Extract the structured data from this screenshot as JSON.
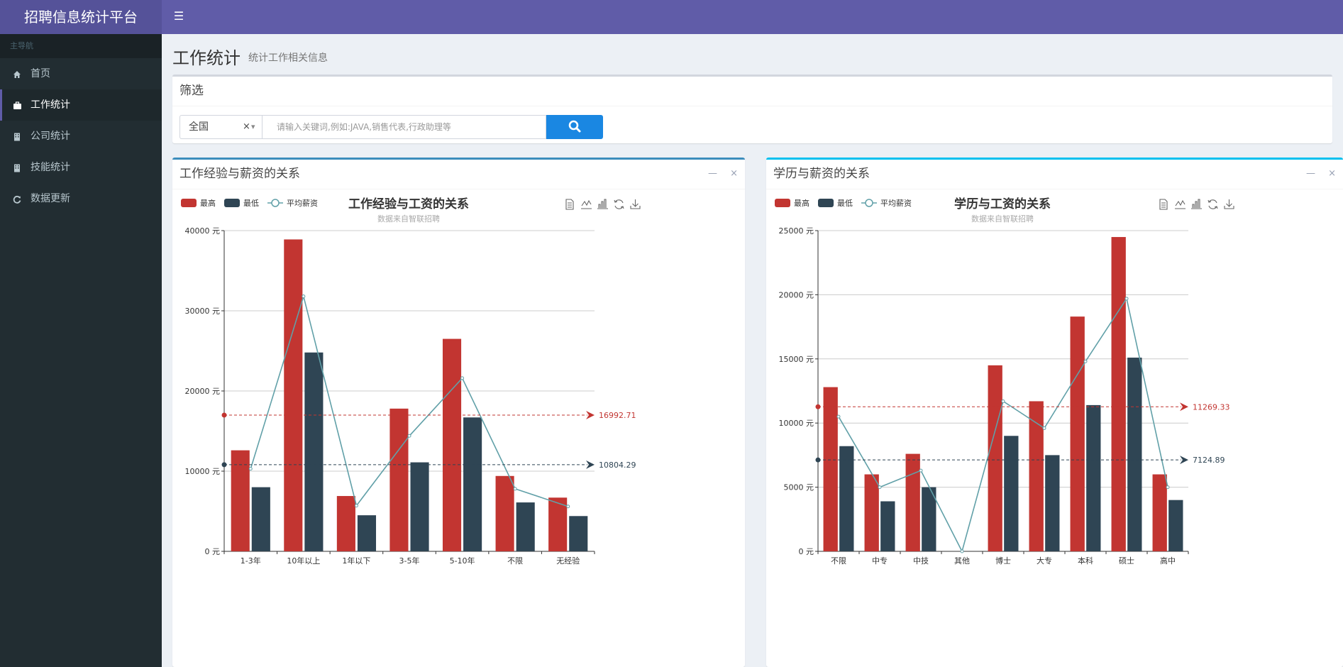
{
  "app": {
    "title": "招聘信息统计平台"
  },
  "sidebar": {
    "header": "主导航",
    "items": [
      {
        "label": "首页",
        "icon": "home-icon"
      },
      {
        "label": "工作统计",
        "icon": "briefcase-icon",
        "active": true
      },
      {
        "label": "公司统计",
        "icon": "building-icon"
      },
      {
        "label": "技能统计",
        "icon": "building-icon"
      },
      {
        "label": "数据更新",
        "icon": "refresh-icon"
      }
    ]
  },
  "page": {
    "title": "工作统计",
    "subtitle": "统计工作相关信息"
  },
  "filter": {
    "title": "筛选",
    "region_value": "全国",
    "search_placeholder": "请输入关键词,例如:JAVA,销售代表,行政助理等"
  },
  "colors": {
    "max": "#c23531",
    "min": "#2f4554",
    "avg": "#61a0a8",
    "header": "#605ca8",
    "sidebar": "#222d32",
    "search_btn": "#1a87e2"
  },
  "chart_data": [
    {
      "box_title": "工作经验与薪资的关系",
      "type": "bar",
      "title": "工作经验与工资的关系",
      "subtitle": "数据来自智联招聘",
      "legend": [
        "最高",
        "最低",
        "平均薪资"
      ],
      "legend_position": "top-left",
      "y_unit": " 元",
      "ylim": [
        0,
        40000
      ],
      "yticks": [
        0,
        10000,
        20000,
        30000,
        40000
      ],
      "categories": [
        "1-3年",
        "10年以上",
        "1年以下",
        "3-5年",
        "5-10年",
        "不限",
        "无经验"
      ],
      "series": [
        {
          "name": "最高",
          "type": "bar",
          "values": [
            12600,
            38900,
            6900,
            17800,
            26500,
            9400,
            6700
          ]
        },
        {
          "name": "最低",
          "type": "bar",
          "values": [
            8000,
            24800,
            4500,
            11100,
            16700,
            6100,
            4400
          ]
        },
        {
          "name": "平均薪资",
          "type": "line",
          "values": [
            10300,
            31800,
            5700,
            14400,
            21600,
            7800,
            5600
          ]
        }
      ],
      "mark_lines": [
        {
          "series": "最高",
          "label": "16992.71",
          "value": 16992.71
        },
        {
          "series": "最低",
          "label": "10804.29",
          "value": 10804.29
        }
      ],
      "grid": true
    },
    {
      "box_title": "学历与薪资的关系",
      "type": "bar",
      "title": "学历与工资的关系",
      "subtitle": "数据来自智联招聘",
      "legend": [
        "最高",
        "最低",
        "平均薪资"
      ],
      "legend_position": "top-left",
      "y_unit": " 元",
      "ylim": [
        0,
        25000
      ],
      "yticks": [
        0,
        5000,
        10000,
        15000,
        20000,
        25000
      ],
      "categories": [
        "不限",
        "中专",
        "中技",
        "其他",
        "博士",
        "大专",
        "本科",
        "硕士",
        "高中"
      ],
      "series": [
        {
          "name": "最高",
          "type": "bar",
          "values": [
            12800,
            6000,
            7600,
            0,
            14500,
            11700,
            18300,
            24500,
            6000
          ]
        },
        {
          "name": "最低",
          "type": "bar",
          "values": [
            8200,
            3900,
            5000,
            0,
            9000,
            7500,
            11400,
            15100,
            4000
          ]
        },
        {
          "name": "平均薪资",
          "type": "line",
          "values": [
            10500,
            5000,
            6300,
            0,
            11700,
            9600,
            14800,
            19700,
            5000
          ]
        }
      ],
      "mark_lines": [
        {
          "series": "最高",
          "label": "11269.33",
          "value": 11269.33
        },
        {
          "series": "最低",
          "label": "7124.89",
          "value": 7124.89
        }
      ],
      "grid": true
    }
  ]
}
